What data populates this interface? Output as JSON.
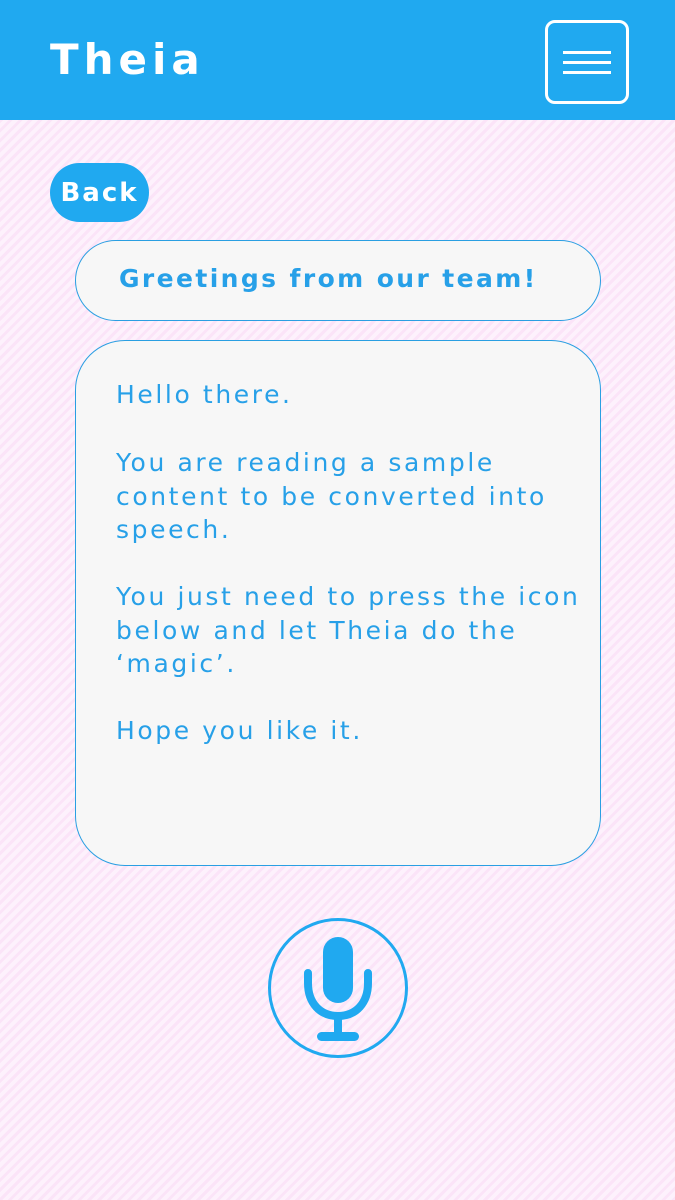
{
  "app": {
    "title": "Theia"
  },
  "header": {
    "menu_icon": "hamburger-menu-icon"
  },
  "nav": {
    "back_label": "Back"
  },
  "message": {
    "title": "Greetings from our team!",
    "paragraphs": [
      "Hello there.",
      "You are reading a sample content to be converted into speech.",
      "You just need to press the icon below and let Theia do the ‘magic’.",
      "Hope you like it."
    ]
  },
  "actions": {
    "speak_icon": "microphone-icon"
  },
  "colors": {
    "accent": "#20a9f0",
    "text": "#27a0e8",
    "background": "#fcecfb",
    "card": "#f7f7f7"
  }
}
